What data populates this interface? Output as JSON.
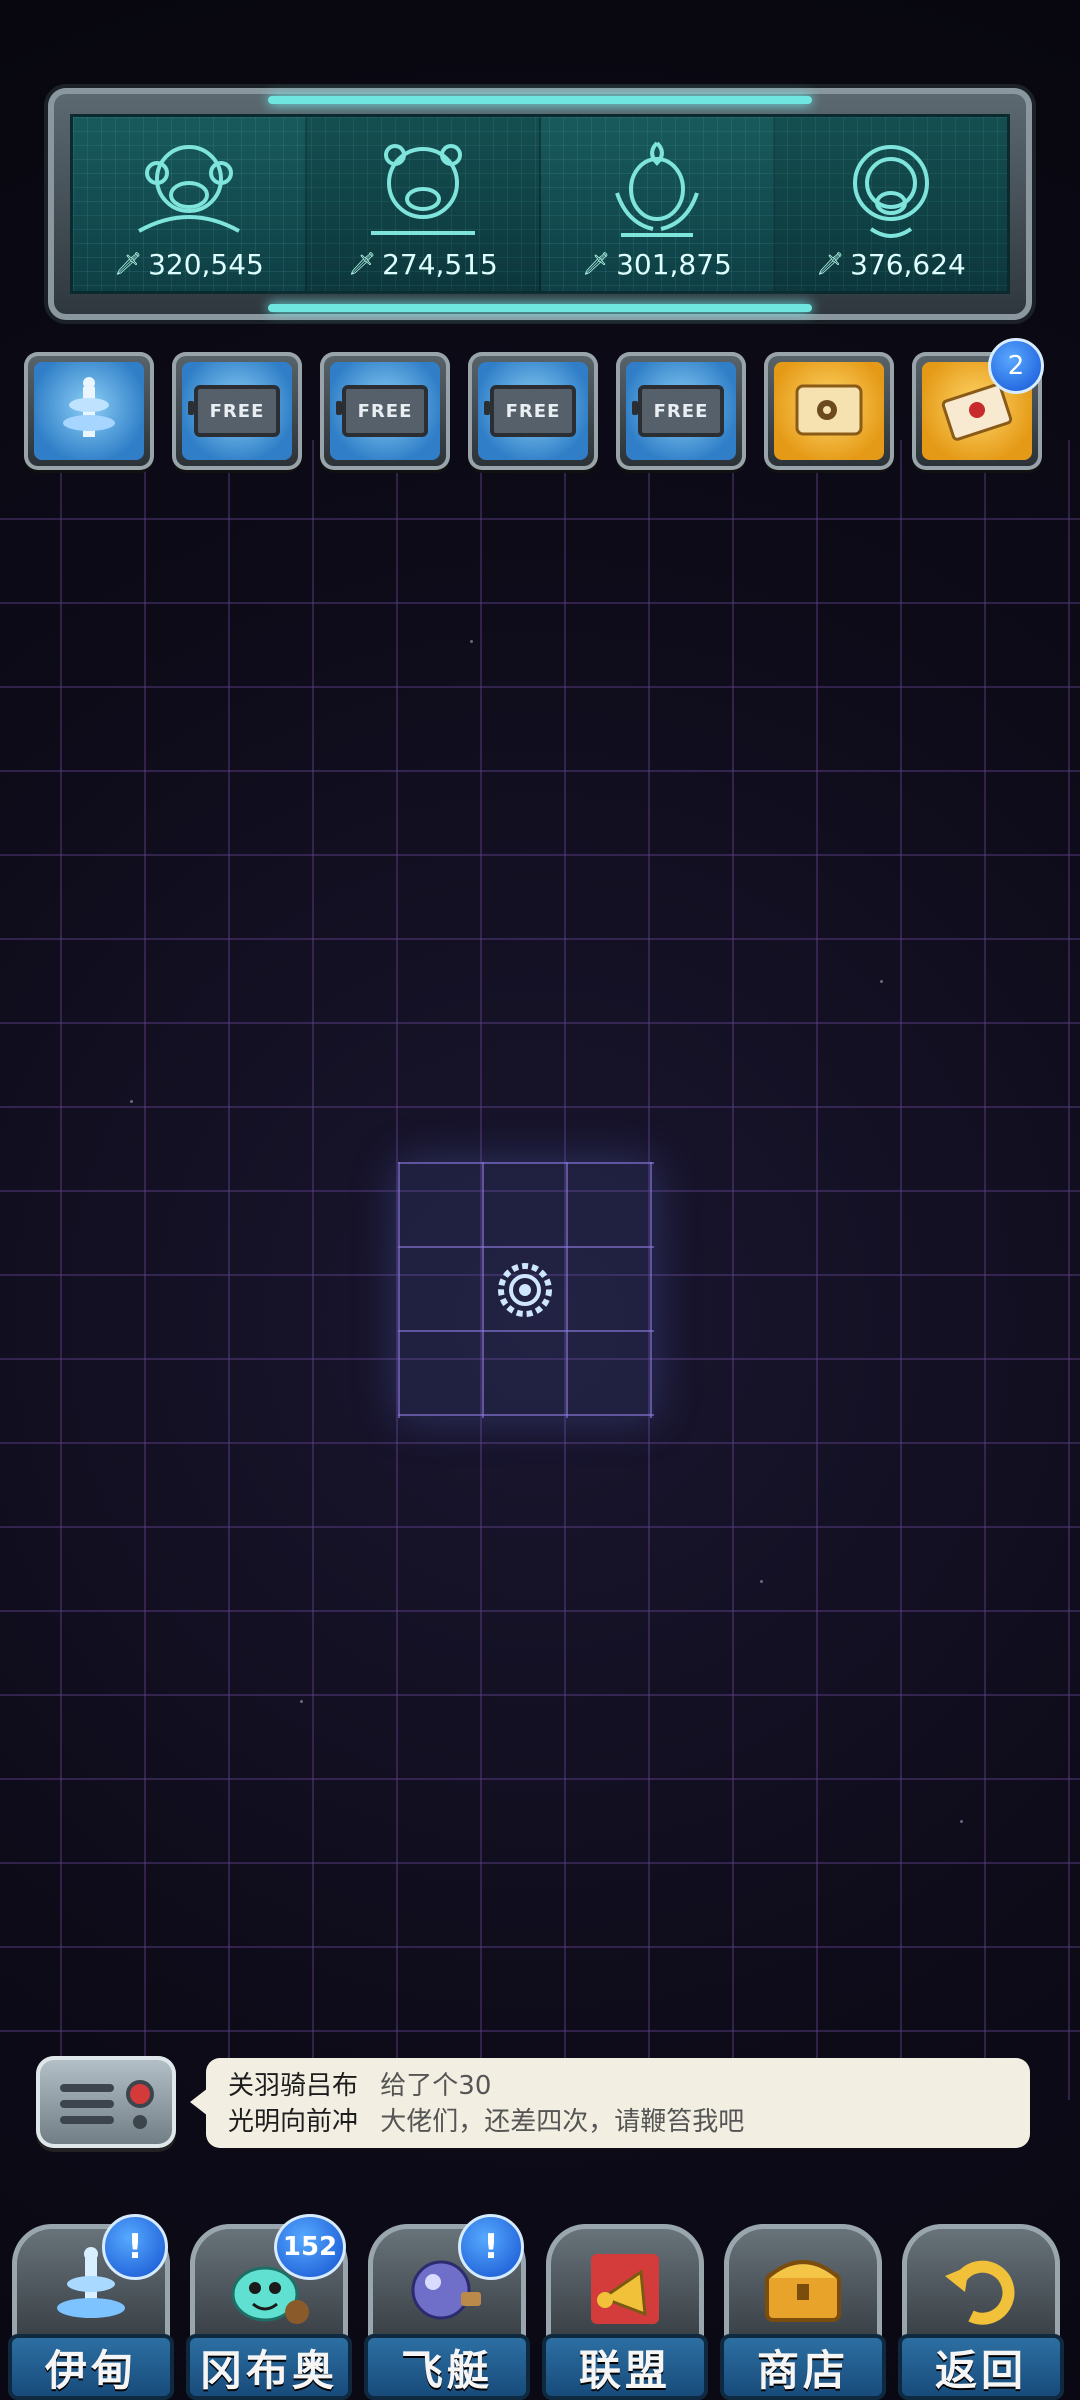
{
  "scores": [
    "320,545",
    "274,515",
    "301,875",
    "376,624"
  ],
  "top_icons": [
    "monkey-head-icon",
    "bear-head-icon",
    "rooster-head-icon",
    "dog-head-icon"
  ],
  "items": [
    {
      "type": "tower",
      "icon": "tower-icon"
    },
    {
      "type": "free",
      "label": "FREE"
    },
    {
      "type": "free",
      "label": "FREE"
    },
    {
      "type": "free",
      "label": "FREE"
    },
    {
      "type": "free",
      "label": "FREE"
    },
    {
      "type": "map",
      "icon": "treasure-map-icon"
    },
    {
      "type": "letter",
      "icon": "letter-icon",
      "badge": "2"
    }
  ],
  "chat": {
    "messages": [
      {
        "user": "关羽骑吕布",
        "text": "给了个30"
      },
      {
        "user": "光明向前冲",
        "text": "大佬们，还差四次，请鞭笞我吧"
      }
    ]
  },
  "nav": [
    {
      "label": "伊甸",
      "badge": "!"
    },
    {
      "label": "冈布奥",
      "badge": "152"
    },
    {
      "label": "飞艇",
      "badge": "!"
    },
    {
      "label": "联盟"
    },
    {
      "label": "商店"
    },
    {
      "label": "返回"
    }
  ],
  "colors": {
    "panel_teal": "#185a5c",
    "badge_blue": "#1452d0",
    "grid_purple": "#7850aa"
  }
}
